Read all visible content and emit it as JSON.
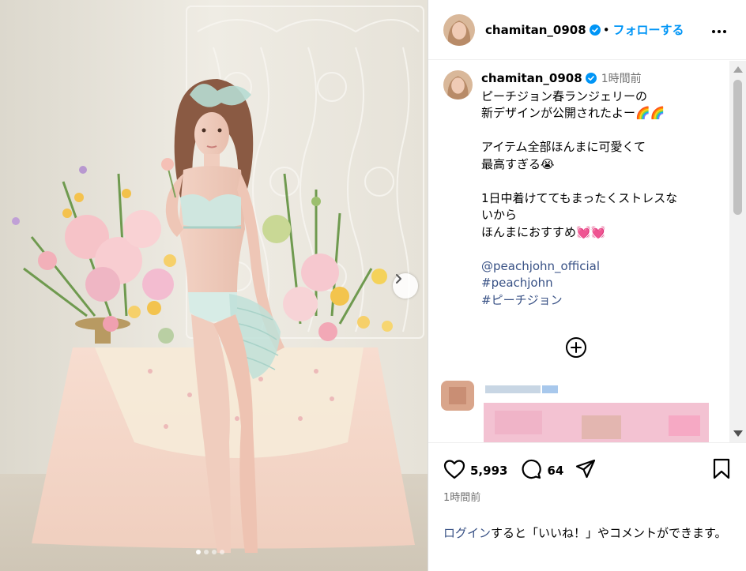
{
  "header": {
    "username": "chamitan_0908",
    "separator": "•",
    "follow_label": "フォローする",
    "more_icon": "more-horizontal-icon"
  },
  "caption": {
    "username": "chamitan_0908",
    "time": "1時間前",
    "lines": [
      "ピーチジョン春ランジェリーの",
      "新デザインが公開されたよー🌈🌈",
      "",
      "アイテム全部ほんまに可愛くて",
      "最高すぎる😭",
      "",
      "1日中着けててもまったくストレスな",
      "いから",
      "ほんまにおすすめ💓💓",
      ""
    ],
    "tags": [
      "@peachjohn_official",
      "#peachjohn",
      "#ピーチジョン"
    ]
  },
  "media": {
    "slide_count": 4,
    "active_slide": 1,
    "next_icon": "chevron-right-icon"
  },
  "actions": {
    "likes": "5,993",
    "comments": "64",
    "like_icon": "heart-icon",
    "comment_icon": "comment-icon",
    "share_icon": "send-icon",
    "save_icon": "bookmark-icon"
  },
  "post_time": "1時間前",
  "login_prompt": {
    "link": "ログイン",
    "text": "すると「いいね！」やコメントができます。"
  },
  "colors": {
    "accent": "#0095f6",
    "link": "#385185",
    "muted": "#737373",
    "verified": "#0095f6"
  }
}
